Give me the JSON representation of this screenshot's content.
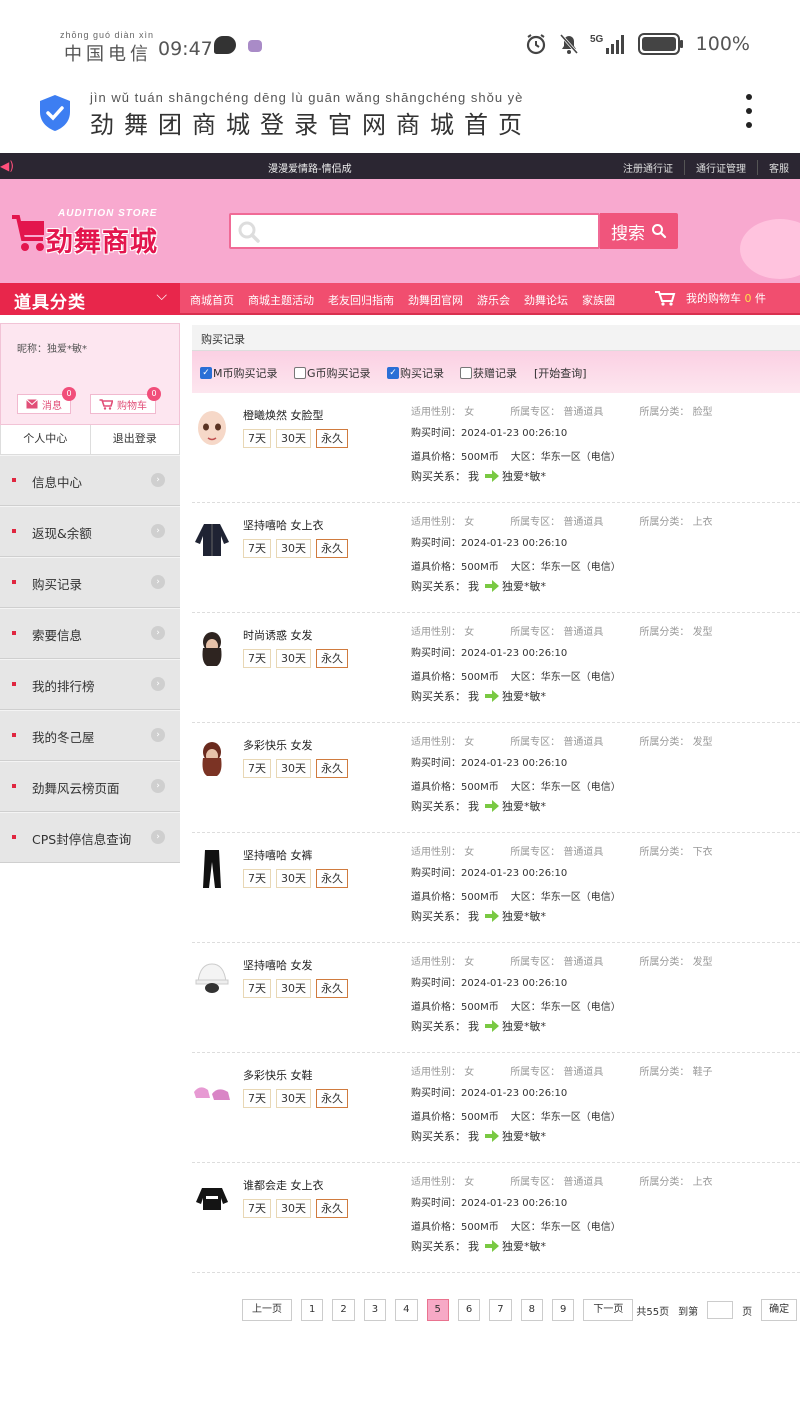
{
  "status_bar": {
    "carrier_pinyin": "zhōng guó diàn xìn",
    "carrier": "中国电信",
    "time": "09:47",
    "network": "5G",
    "battery": "100%"
  },
  "title_bar": {
    "pinyin": "jìn  wǔ  tuán shāngchéng dēng  lù  guān wǎng shāngchéng shǒu  yè",
    "title": "劲舞团商城登录官网商城首页"
  },
  "top_strip": {
    "music": "漫漫爱情路-情侣成",
    "links": [
      "注册通行证",
      "通行证管理",
      "客服"
    ]
  },
  "logo": {
    "en": "AUDITION   STORE",
    "cn": "劲舞商城"
  },
  "search": {
    "placeholder": "",
    "button": "搜索"
  },
  "nav": {
    "category": "道具分类",
    "links": [
      "商城首页",
      "商城主题活动",
      "老友回归指南",
      "劲舞团官网",
      "游乐会",
      "劲舞论坛",
      "家族圈"
    ],
    "cart_label": "我的购物车",
    "cart_count": "0",
    "cart_unit": "件"
  },
  "sidebar": {
    "nickname": "昵称：独爱*敏*",
    "msg_label": "消息",
    "msg_badge": "0",
    "cart_label": "购物车",
    "cart_badge": "0",
    "personal_center": "个人中心",
    "logout": "退出登录",
    "menu": [
      "信息中心",
      "返现&余额",
      "购买记录",
      "索要信息",
      "我的排行榜",
      "我的冬己屋",
      "劲舞风云榜页面",
      "CPS封停信息查询"
    ]
  },
  "main": {
    "title": "购买记录",
    "filters": [
      {
        "label": "M币购买记录",
        "checked": true
      },
      {
        "label": "G币购买记录",
        "checked": false
      },
      {
        "label": "购买记录",
        "checked": true
      },
      {
        "label": "获赠记录",
        "checked": false
      }
    ],
    "query": "[开始查询]",
    "labels": {
      "gender": "适用性别：",
      "zone": "所属专区：",
      "category": "所属分类：",
      "time": "购买时间：",
      "price": "道具价格：",
      "region": "大区：",
      "relation": "购买关系：",
      "me": "我"
    },
    "durations": [
      "7天",
      "30天",
      "永久"
    ],
    "items": [
      {
        "name": "橙曦焕然 女脸型",
        "gender": "女",
        "zone": "普通道具",
        "category": "脸型",
        "time": "2024-01-23 00:26:10",
        "price": "500M币",
        "region": "华东一区（电信）",
        "to": "独爱*敏*",
        "thumb": "face"
      },
      {
        "name": "坚持嘻哈 女上衣",
        "gender": "女",
        "zone": "普通道具",
        "category": "上衣",
        "time": "2024-01-23 00:26:10",
        "price": "500M币",
        "region": "华东一区（电信）",
        "to": "独爱*敏*",
        "thumb": "jacket"
      },
      {
        "name": "时尚诱惑 女发",
        "gender": "女",
        "zone": "普通道具",
        "category": "发型",
        "time": "2024-01-23 00:26:10",
        "price": "500M币",
        "region": "华东一区（电信）",
        "to": "独爱*敏*",
        "thumb": "hair1"
      },
      {
        "name": "多彩快乐 女发",
        "gender": "女",
        "zone": "普通道具",
        "category": "发型",
        "time": "2024-01-23 00:26:10",
        "price": "500M币",
        "region": "华东一区（电信）",
        "to": "独爱*敏*",
        "thumb": "hair2"
      },
      {
        "name": "坚持嘻哈 女裤",
        "gender": "女",
        "zone": "普通道具",
        "category": "下衣",
        "time": "2024-01-23 00:26:10",
        "price": "500M币",
        "region": "华东一区（电信）",
        "to": "独爱*敏*",
        "thumb": "pants"
      },
      {
        "name": "坚持嘻哈 女发",
        "gender": "女",
        "zone": "普通道具",
        "category": "发型",
        "time": "2024-01-23 00:26:10",
        "price": "500M币",
        "region": "华东一区（电信）",
        "to": "独爱*敏*",
        "thumb": "hat"
      },
      {
        "name": "多彩快乐 女鞋",
        "gender": "女",
        "zone": "普通道具",
        "category": "鞋子",
        "time": "2024-01-23 00:26:10",
        "price": "500M币",
        "region": "华东一区（电信）",
        "to": "独爱*敏*",
        "thumb": "shoes"
      },
      {
        "name": "谁都会走 女上衣",
        "gender": "女",
        "zone": "普通道具",
        "category": "上衣",
        "time": "2024-01-23 00:26:10",
        "price": "500M币",
        "region": "华东一区（电信）",
        "to": "独爱*敏*",
        "thumb": "top"
      }
    ]
  },
  "pager": {
    "prev": "上一页",
    "pages": [
      "1",
      "2",
      "3",
      "4",
      "5",
      "6",
      "7",
      "8",
      "9"
    ],
    "current": "5",
    "next": "下一页",
    "total": "共55页",
    "goto": "到第",
    "goto_unit": "页",
    "confirm": "确定"
  },
  "colors": {
    "brand_pink": "#f8a9cf",
    "nav_red": "#f14e6f",
    "accent": "#e3154d"
  }
}
